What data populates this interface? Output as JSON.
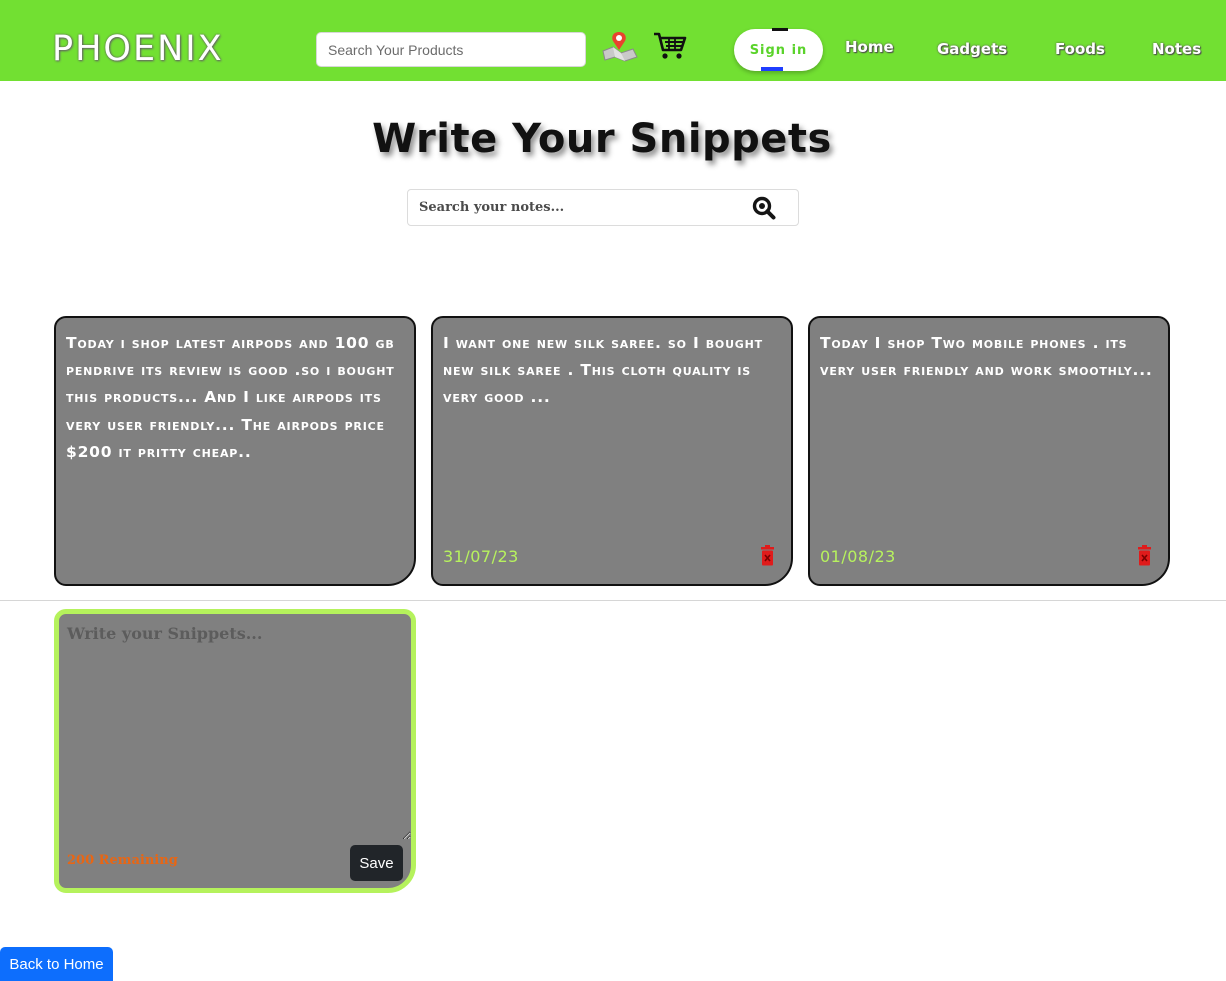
{
  "navbar": {
    "brand": "PHOENIX",
    "search_placeholder": "Search Your Products",
    "signin_label": "Sign in",
    "links": [
      "Home",
      "Gadgets",
      "Foods",
      "Notes"
    ],
    "icons": [
      "map-location-icon",
      "cart-icon"
    ],
    "colors": {
      "bar": "#72e032",
      "signin_text": "#5ad32a"
    }
  },
  "main": {
    "title": "Write Your Snippets",
    "search_placeholder": "Search your notes...",
    "search_icon": "search-icon"
  },
  "notes": [
    {
      "text": "Today i shop latest airpods and 100 gb pendrive its review is good .so i bought this products... And I like airpods its very user friendly... The airpods price $200 it pritty cheap..",
      "date": ""
    },
    {
      "text": "I want one new silk saree. so I bought new silk saree . This cloth quality is very good ...",
      "date": "31/07/23"
    },
    {
      "text": "Today I shop Two mobile phones . its very user friendly and work smoothly...",
      "date": "01/08/23"
    }
  ],
  "editor": {
    "placeholder": "Write your Snippets...",
    "remaining": "200 Remaining",
    "save_label": "Save"
  },
  "footer": {
    "back_label": "Back to Home"
  },
  "colors": {
    "card_bg": "#808080",
    "date": "#b7f25e",
    "delete": "#e01b1b",
    "editor_border": "#b5f25c",
    "remaining": "#e86614"
  }
}
